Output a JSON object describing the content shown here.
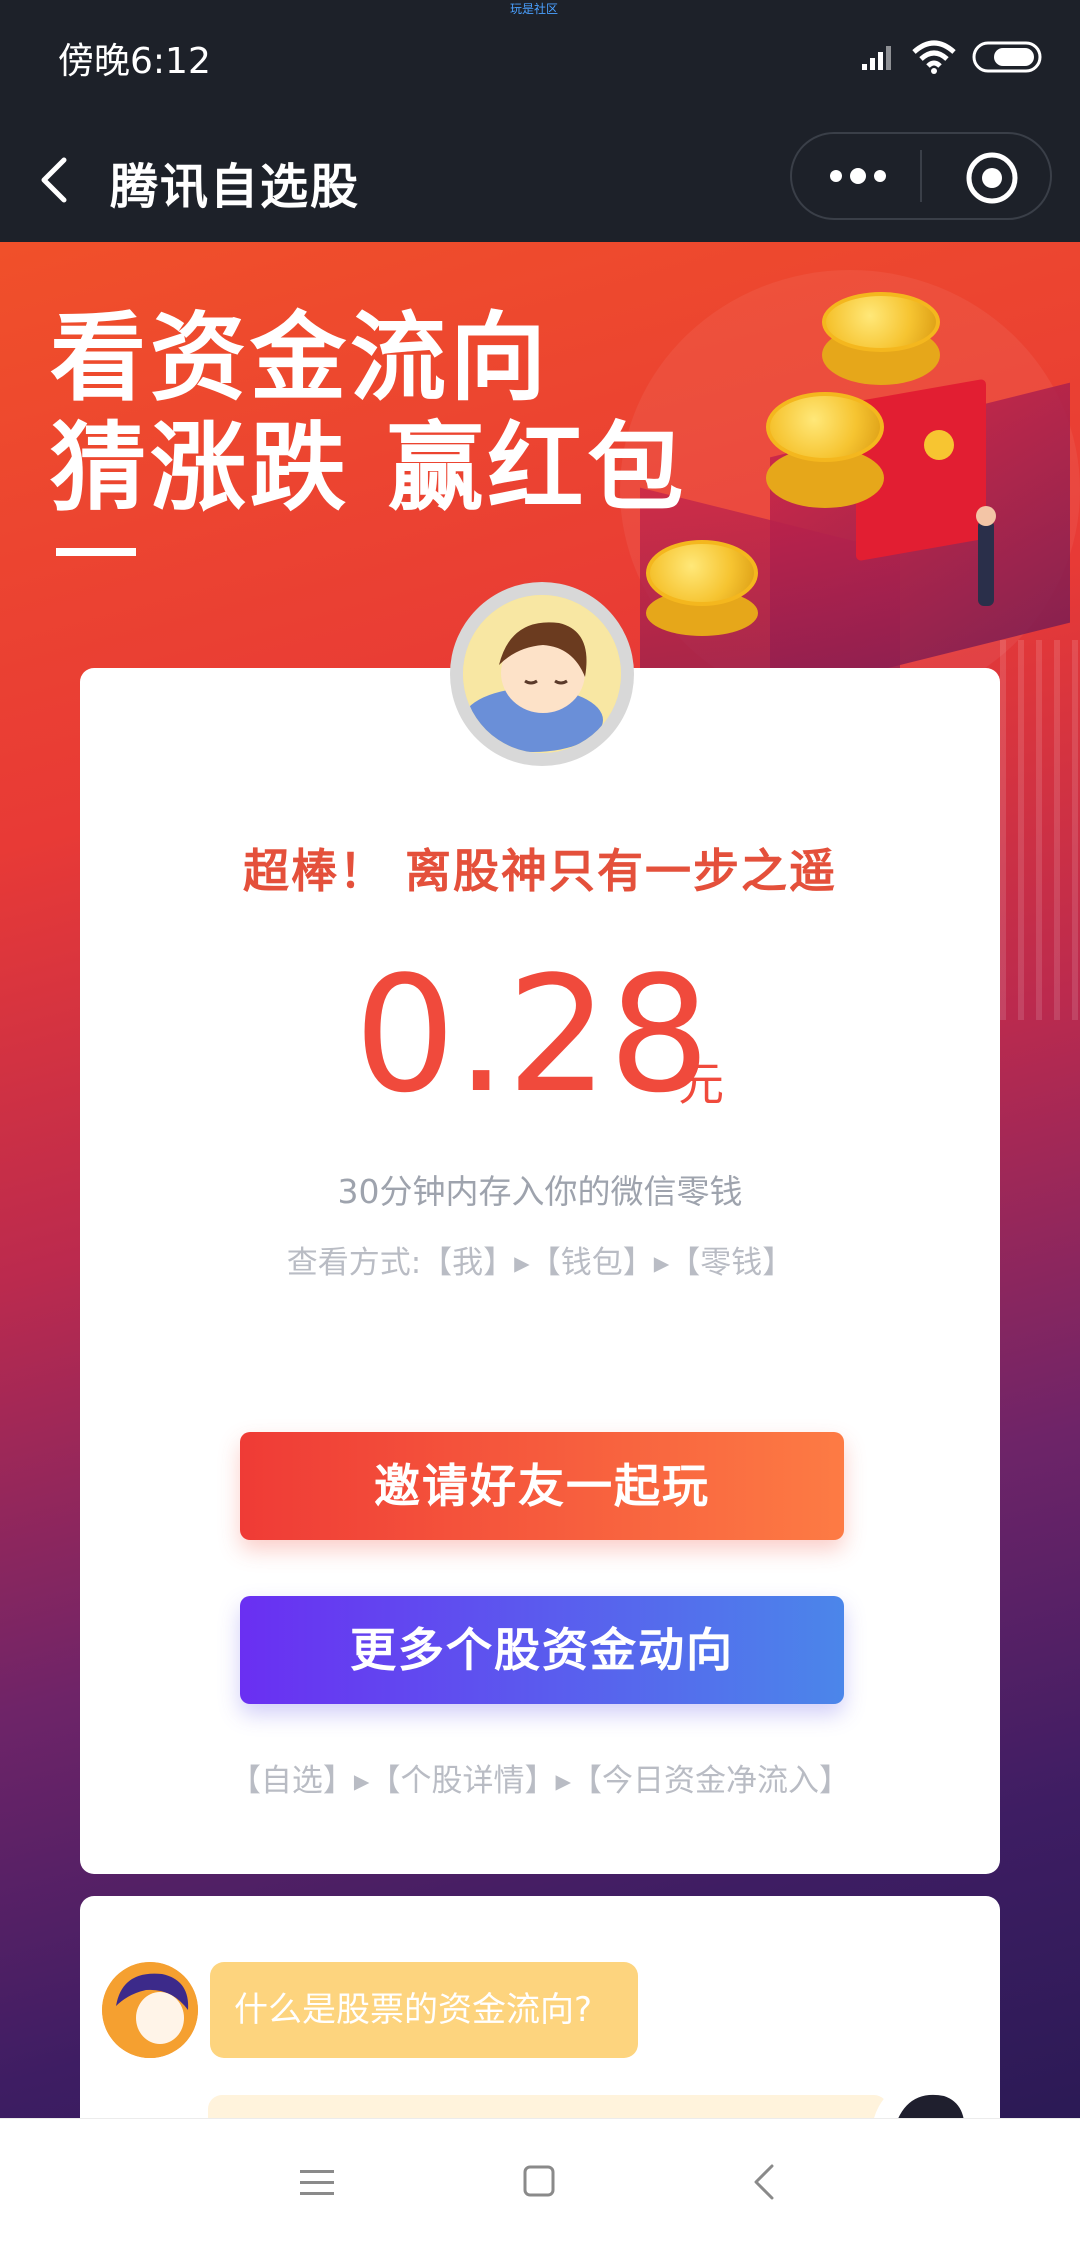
{
  "status_bar": {
    "time": "傍晚6:12",
    "top_label": "玩是社区",
    "icons": [
      "signal-icon",
      "wifi-icon",
      "battery-icon"
    ]
  },
  "title_bar": {
    "title": "腾讯自选股",
    "icons": [
      "back-icon",
      "more-icon",
      "close-target-icon"
    ]
  },
  "hero": {
    "line1": "看资金流向",
    "line2": "猜涨跌 赢红包"
  },
  "result_card": {
    "headline": "超棒！ 离股神只有一步之遥",
    "amount": "0.28",
    "unit": "元",
    "deposit_note": "30分钟内存入你的微信零钱",
    "view_method": "查看方式:【我】▸【钱包】▸【零钱】",
    "invite_button": "邀请好友一起玩",
    "more_button": "更多个股资金动向",
    "path_note": "【自选】▸【个股详情】▸【今日资金净流入】"
  },
  "chat": {
    "question": "什么是股票的资金流向?"
  },
  "nav_bar": {
    "icons": [
      "menu-icon",
      "home-icon",
      "back-nav-icon"
    ]
  },
  "colors": {
    "accent_red": "#f04a3c",
    "button_orange": "#fd7b44",
    "button_purple": "#6a2ff2",
    "button_blue": "#4b86ea",
    "bubble_yellow": "#fdd47e",
    "bar_dark": "#1d2129"
  }
}
